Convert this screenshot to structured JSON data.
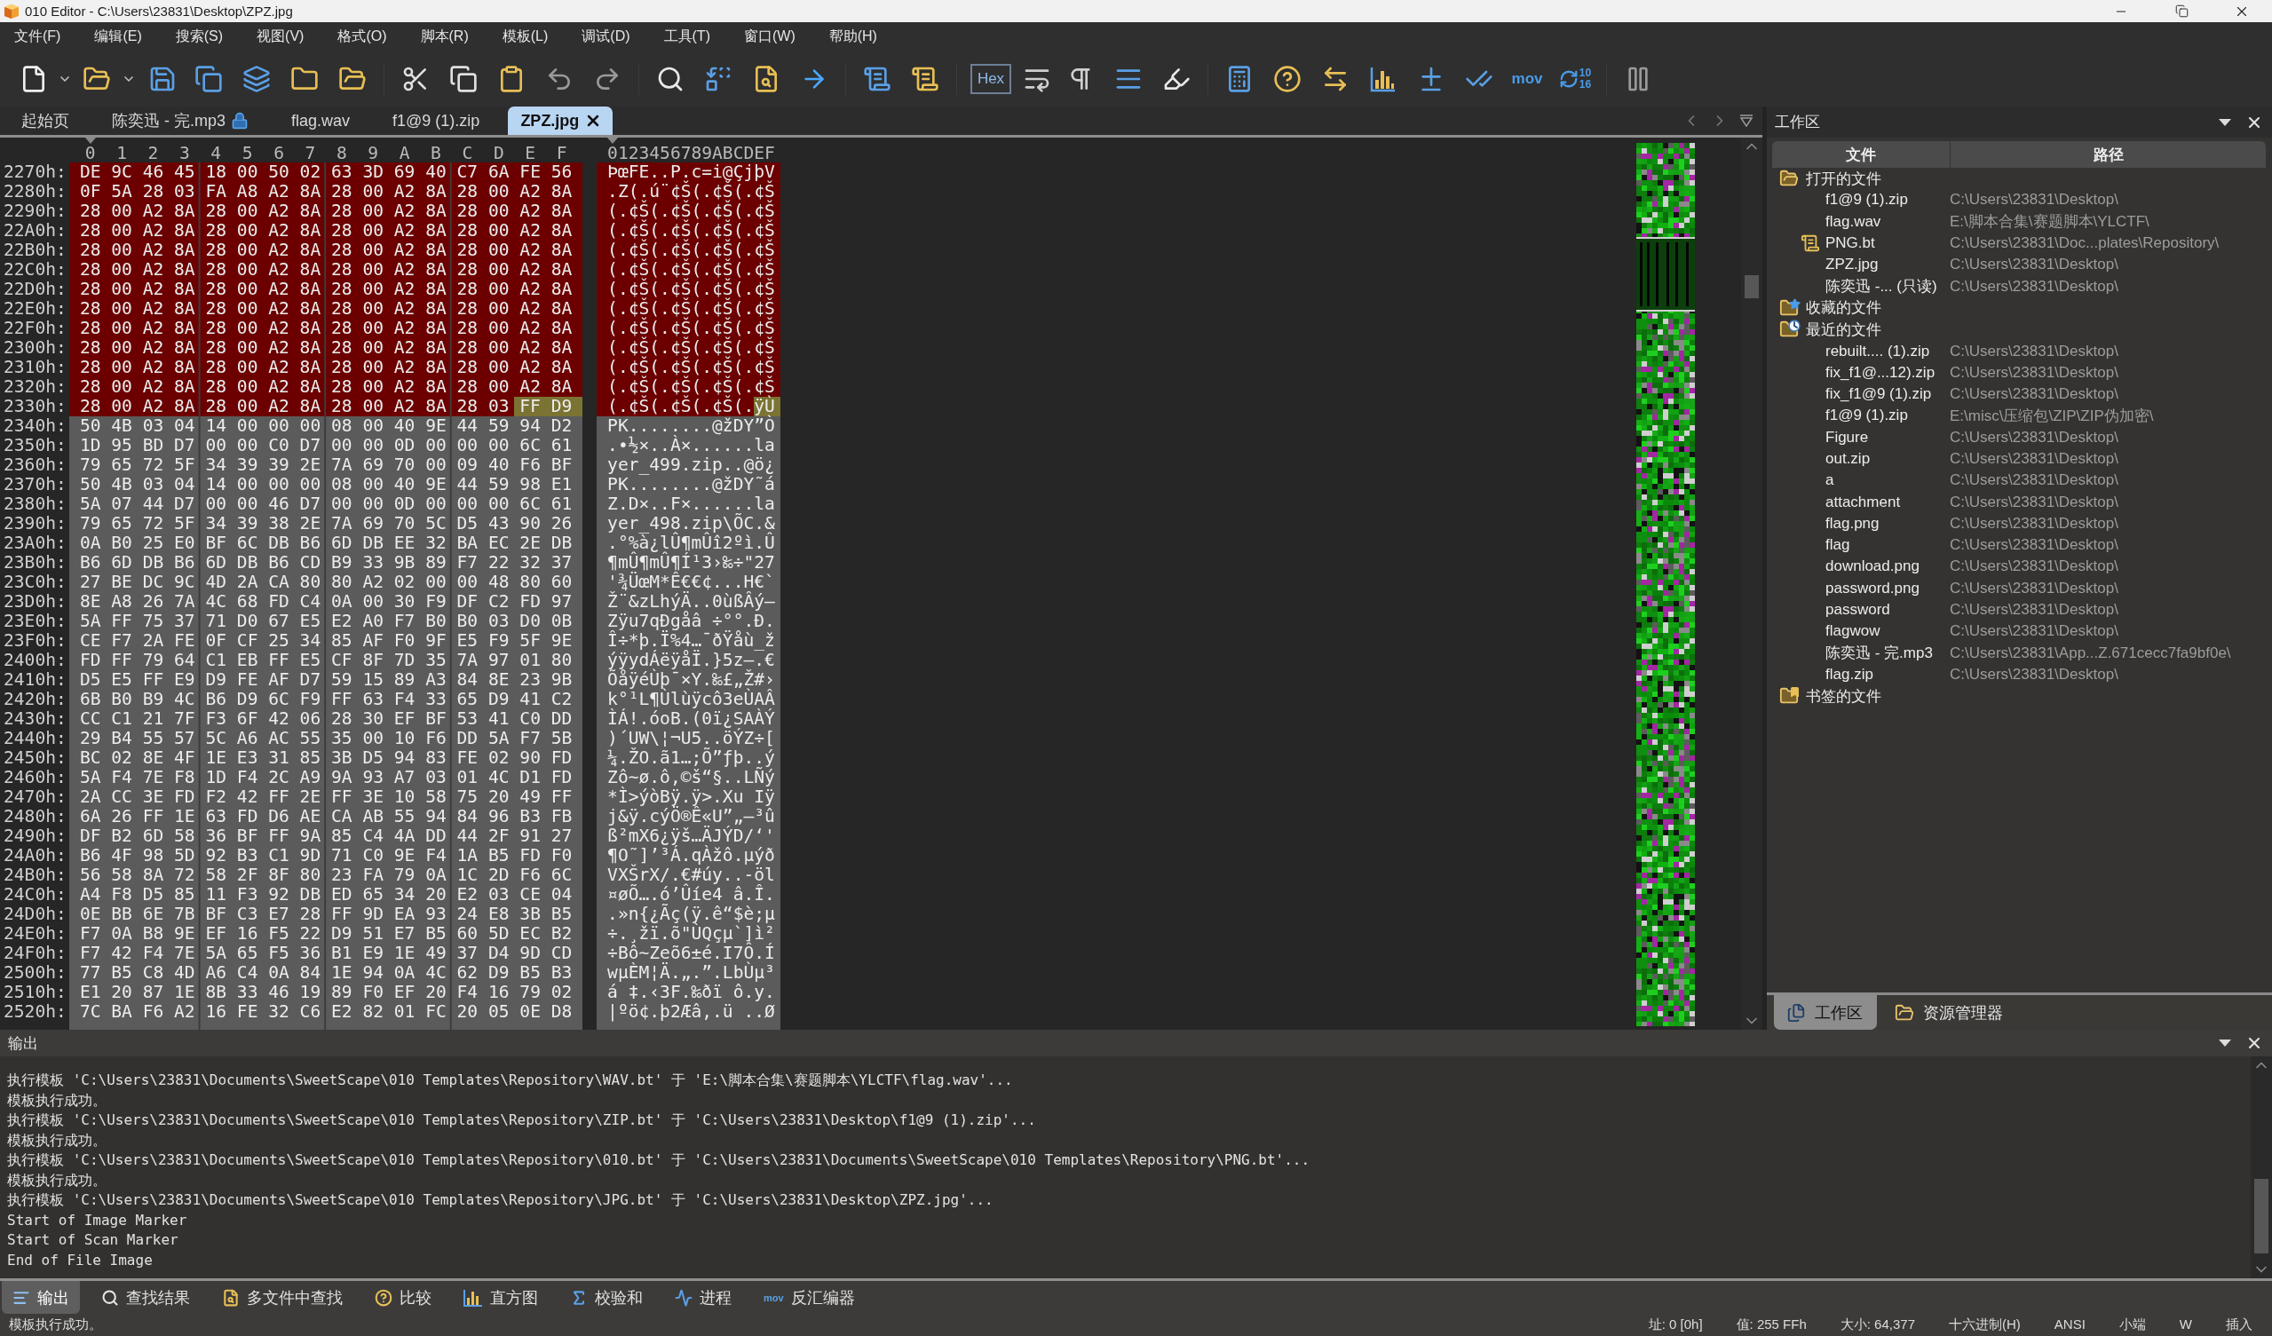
{
  "window": {
    "title": "010 Editor - C:\\Users\\23831\\Desktop\\ZPZ.jpg"
  },
  "menu": [
    "文件(F)",
    "编辑(E)",
    "搜索(S)",
    "视图(V)",
    "格式(O)",
    "脚本(R)",
    "模板(L)",
    "调试(D)",
    "工具(T)",
    "窗口(W)",
    "帮助(H)"
  ],
  "toolbar": {
    "hex_toggle": {
      "label": "Hex",
      "on": true
    },
    "disassembler_label": "mov",
    "base_labels": [
      "10",
      "16"
    ]
  },
  "tabs": [
    {
      "label": "起始页",
      "selected": false,
      "locked": false
    },
    {
      "label": "陈奕迅 - 完.mp3",
      "selected": false,
      "locked": true
    },
    {
      "label": "flag.wav",
      "selected": false,
      "locked": false
    },
    {
      "label": "f1@9 (1).zip",
      "selected": false,
      "locked": false
    },
    {
      "label": "ZPZ.jpg",
      "selected": true,
      "locked": false
    }
  ],
  "hex_view": {
    "column_headers": [
      "0",
      "1",
      "2",
      "3",
      "4",
      "5",
      "6",
      "7",
      "8",
      "9",
      "A",
      "B",
      "C",
      "D",
      "E",
      "F"
    ],
    "ascii_header": "0123456789ABCDEF",
    "rows": [
      {
        "offset": "2270h:",
        "groups": [
          {
            "kind": "scan-data",
            "hex": "DE 9C 46 45 18 00 50 02 63 3D 69 40 C7 6A FE 56",
            "ascii": "ÞœFE..P.c=i@ÇjþV"
          }
        ]
      },
      {
        "offset": "2280h:",
        "groups": [
          {
            "kind": "scan-data",
            "hex": "0F 5A 28 03 FA A8 A2 8A 28 00 A2 8A 28 00 A2 8A",
            "ascii": ".Z(.ú¨¢Š(.¢Š(.¢Š"
          }
        ]
      },
      {
        "offset": "2290h:",
        "groups": [
          {
            "kind": "scan-data",
            "hex": "28 00 A2 8A 28 00 A2 8A 28 00 A2 8A 28 00 A2 8A",
            "ascii": "(.¢Š(.¢Š(.¢Š(.¢Š"
          }
        ]
      },
      {
        "offset": "22A0h:",
        "groups": [
          {
            "kind": "scan-data",
            "hex": "28 00 A2 8A 28 00 A2 8A 28 00 A2 8A 28 00 A2 8A",
            "ascii": "(.¢Š(.¢Š(.¢Š(.¢Š"
          }
        ]
      },
      {
        "offset": "22B0h:",
        "groups": [
          {
            "kind": "scan-data",
            "hex": "28 00 A2 8A 28 00 A2 8A 28 00 A2 8A 28 00 A2 8A",
            "ascii": "(.¢Š(.¢Š(.¢Š(.¢Š"
          }
        ]
      },
      {
        "offset": "22C0h:",
        "groups": [
          {
            "kind": "scan-data",
            "hex": "28 00 A2 8A 28 00 A2 8A 28 00 A2 8A 28 00 A2 8A",
            "ascii": "(.¢Š(.¢Š(.¢Š(.¢Š"
          }
        ]
      },
      {
        "offset": "22D0h:",
        "groups": [
          {
            "kind": "scan-data",
            "hex": "28 00 A2 8A 28 00 A2 8A 28 00 A2 8A 28 00 A2 8A",
            "ascii": "(.¢Š(.¢Š(.¢Š(.¢Š"
          }
        ]
      },
      {
        "offset": "22E0h:",
        "groups": [
          {
            "kind": "scan-data",
            "hex": "28 00 A2 8A 28 00 A2 8A 28 00 A2 8A 28 00 A2 8A",
            "ascii": "(.¢Š(.¢Š(.¢Š(.¢Š"
          }
        ]
      },
      {
        "offset": "22F0h:",
        "groups": [
          {
            "kind": "scan-data",
            "hex": "28 00 A2 8A 28 00 A2 8A 28 00 A2 8A 28 00 A2 8A",
            "ascii": "(.¢Š(.¢Š(.¢Š(.¢Š"
          }
        ]
      },
      {
        "offset": "2300h:",
        "groups": [
          {
            "kind": "scan-data",
            "hex": "28 00 A2 8A 28 00 A2 8A 28 00 A2 8A 28 00 A2 8A",
            "ascii": "(.¢Š(.¢Š(.¢Š(.¢Š"
          }
        ]
      },
      {
        "offset": "2310h:",
        "groups": [
          {
            "kind": "scan-data",
            "hex": "28 00 A2 8A 28 00 A2 8A 28 00 A2 8A 28 00 A2 8A",
            "ascii": "(.¢Š(.¢Š(.¢Š(.¢Š"
          }
        ]
      },
      {
        "offset": "2320h:",
        "groups": [
          {
            "kind": "scan-data",
            "hex": "28 00 A2 8A 28 00 A2 8A 28 00 A2 8A 28 00 A2 8A",
            "ascii": "(.¢Š(.¢Š(.¢Š(.¢Š"
          }
        ]
      },
      {
        "offset": "2330h:",
        "groups": [
          {
            "kind": "scan-data",
            "hex": "28 00 A2 8A 28 00 A2 8A 28 00 A2 8A 28 03",
            "ascii": "(.¢Š(.¢Š(.¢Š(."
          },
          {
            "kind": "end-marker",
            "hex": "FF D9",
            "ascii": "ÿÙ"
          }
        ]
      },
      {
        "offset": "2340h:",
        "groups": [
          {
            "kind": "plain",
            "hex": "50 4B 03 04 14 00 00 00 08 00 40 9E 44 59 94 D2",
            "ascii": "PK........@žDY”Ò"
          }
        ]
      },
      {
        "offset": "2350h:",
        "groups": [
          {
            "kind": "plain",
            "hex": "1D 95 BD D7 00 00 C0 D7 00 00 0D 00 00 00 6C 61",
            "ascii": ".•½×..À×......la"
          }
        ]
      },
      {
        "offset": "2360h:",
        "groups": [
          {
            "kind": "plain",
            "hex": "79 65 72 5F 34 39 39 2E 7A 69 70 00 09 40 F6 BF",
            "ascii": "yer_499.zip..@ö¿"
          }
        ]
      },
      {
        "offset": "2370h:",
        "groups": [
          {
            "kind": "plain",
            "hex": "50 4B 03 04 14 00 00 00 08 00 40 9E 44 59 98 E1",
            "ascii": "PK........@žDY˜á"
          }
        ]
      },
      {
        "offset": "2380h:",
        "groups": [
          {
            "kind": "plain",
            "hex": "5A 07 44 D7 00 00 46 D7 00 00 0D 00 00 00 6C 61",
            "ascii": "Z.D×..F×......la"
          }
        ]
      },
      {
        "offset": "2390h:",
        "groups": [
          {
            "kind": "plain",
            "hex": "79 65 72 5F 34 39 38 2E 7A 69 70 5C D5 43 90 26",
            "ascii": "yer_498.zip\\ÕC.&"
          }
        ]
      },
      {
        "offset": "23A0h:",
        "groups": [
          {
            "kind": "plain",
            "hex": "0A B0 25 E0 BF 6C DB B6 6D DB EE 32 BA EC 2E DB",
            "ascii": ".°%à¿lÛ¶mÛî2ºì.Û"
          }
        ]
      },
      {
        "offset": "23B0h:",
        "groups": [
          {
            "kind": "plain",
            "hex": "B6 6D DB B6 6D DB B6 CD B9 33 9B 89 F7 22 32 37",
            "ascii": "¶mÛ¶mÛ¶Í¹3›‰÷\"27"
          }
        ]
      },
      {
        "offset": "23C0h:",
        "groups": [
          {
            "kind": "plain",
            "hex": "27 BE DC 9C 4D 2A CA 80 80 A2 02 00 00 48 80 60",
            "ascii": "'¾ÜœM*Ê€€¢...H€`"
          }
        ]
      },
      {
        "offset": "23D0h:",
        "groups": [
          {
            "kind": "plain",
            "hex": "8E A8 26 7A 4C 68 FD C4 0A 00 30 F9 DF C2 FD 97",
            "ascii": "Ž¨&zLhýÄ..0ùßÂý—"
          }
        ]
      },
      {
        "offset": "23E0h:",
        "groups": [
          {
            "kind": "plain",
            "hex": "5A FF 75 37 71 D0 67 E5 E2 A0 F7 B0 B0 03 D0 0B",
            "ascii": "Zÿu7qÐgåâ ÷°°.Ð."
          }
        ]
      },
      {
        "offset": "23F0h:",
        "groups": [
          {
            "kind": "plain",
            "hex": "CE F7 2A FE 0F CF 25 34 85 AF F0 9F E5 F9 5F 9E",
            "ascii": "Î÷*þ.Ï%4…¯ðŸåù_ž"
          }
        ]
      },
      {
        "offset": "2400h:",
        "groups": [
          {
            "kind": "plain",
            "hex": "FD FF 79 64 C1 EB FF E5 CF 8F 7D 35 7A 97 01 80",
            "ascii": "ýÿydÁëÿåÏ.}5z—.€"
          }
        ]
      },
      {
        "offset": "2410h:",
        "groups": [
          {
            "kind": "plain",
            "hex": "D5 E5 FF E9 D9 FE AF D7 59 15 89 A3 84 8E 23 9B",
            "ascii": "ÕåÿéÙþ¯×Y.‰£„Ž#›"
          }
        ]
      },
      {
        "offset": "2420h:",
        "groups": [
          {
            "kind": "plain",
            "hex": "6B B0 B9 4C B6 D9 6C F9 FF 63 F4 33 65 D9 41 C2",
            "ascii": "k°¹L¶Ùlùÿcô3eÙAÂ"
          }
        ]
      },
      {
        "offset": "2430h:",
        "groups": [
          {
            "kind": "plain",
            "hex": "CC C1 21 7F F3 6F 42 06 28 30 EF BF 53 41 C0 DD",
            "ascii": "ÌÁ!.óoB.(0ï¿SAÀÝ"
          }
        ]
      },
      {
        "offset": "2440h:",
        "groups": [
          {
            "kind": "plain",
            "hex": "29 B4 55 57 5C A6 AC 55 35 00 10 F6 DD 5A F7 5B",
            "ascii": ")´UW\\¦¬U5..öÝZ÷["
          }
        ]
      },
      {
        "offset": "2450h:",
        "groups": [
          {
            "kind": "plain",
            "hex": "BC 02 8E 4F 1E E3 31 85 3B D5 94 83 FE 02 90 FD",
            "ascii": "¼.ŽO.ã1…;Õ”ƒþ..ý"
          }
        ]
      },
      {
        "offset": "2460h:",
        "groups": [
          {
            "kind": "plain",
            "hex": "5A F4 7E F8 1D F4 2C A9 9A 93 A7 03 01 4C D1 FD",
            "ascii": "Zô~ø.ô,©š“§..LÑý"
          }
        ]
      },
      {
        "offset": "2470h:",
        "groups": [
          {
            "kind": "plain",
            "hex": "2A CC 3E FD F2 42 FF 2E FF 3E 10 58 75 20 49 FF",
            "ascii": "*Ì>ýòBÿ.ÿ>.Xu Iÿ"
          }
        ]
      },
      {
        "offset": "2480h:",
        "groups": [
          {
            "kind": "plain",
            "hex": "6A 26 FF 1E 63 FD D6 AE CA AB 55 94 84 96 B3 FB",
            "ascii": "j&ÿ.cýÖ®Ê«U”„–³û"
          }
        ]
      },
      {
        "offset": "2490h:",
        "groups": [
          {
            "kind": "plain",
            "hex": "DF B2 6D 58 36 BF FF 9A 85 C4 4A DD 44 2F 91 27",
            "ascii": "ß²mX6¿ÿš…ÄJÝD/‘'"
          }
        ]
      },
      {
        "offset": "24A0h:",
        "groups": [
          {
            "kind": "plain",
            "hex": "B6 4F 98 5D 92 B3 C1 9D 71 C0 9E F4 1A B5 FD F0",
            "ascii": "¶O˜]’³Á.qÀžô.µýð"
          }
        ]
      },
      {
        "offset": "24B0h:",
        "groups": [
          {
            "kind": "plain",
            "hex": "56 58 8A 72 58 2F 8F 80 23 FA 79 0A 1C 2D F6 6C",
            "ascii": "VXŠrX/.€#úy..-öl"
          }
        ]
      },
      {
        "offset": "24C0h:",
        "groups": [
          {
            "kind": "plain",
            "hex": "A4 F8 D5 85 11 F3 92 DB ED 65 34 20 E2 03 CE 04",
            "ascii": "¤øÕ….ó’Ûíe4 â.Î."
          }
        ]
      },
      {
        "offset": "24D0h:",
        "groups": [
          {
            "kind": "plain",
            "hex": "0E BB 6E 7B BF C3 E7 28 FF 9D EA 93 24 E8 3B B5",
            "ascii": ".»n{¿Ãç(ÿ.ê“$è;µ"
          }
        ]
      },
      {
        "offset": "24E0h:",
        "groups": [
          {
            "kind": "plain",
            "hex": "F7 0A B8 9E EF 16 F5 22 D9 51 E7 B5 60 5D EC B2",
            "ascii": "÷.¸žï.õ\"ÙQçµ`]ì²"
          }
        ]
      },
      {
        "offset": "24F0h:",
        "groups": [
          {
            "kind": "plain",
            "hex": "F7 42 F4 7E 5A 65 F5 36 B1 E9 1E 49 37 D4 9D CD",
            "ascii": "÷Bô~Zeõ6±é.I7Ô.Í"
          }
        ]
      },
      {
        "offset": "2500h:",
        "groups": [
          {
            "kind": "plain",
            "hex": "77 B5 C8 4D A6 C4 0A 84 1E 94 0A 4C 62 D9 B5 B3",
            "ascii": "wµÈM¦Ä.„.”.LbÙµ³"
          }
        ]
      },
      {
        "offset": "2510h:",
        "groups": [
          {
            "kind": "plain",
            "hex": "E1 20 87 1E 8B 33 46 19 89 F0 EF 20 F4 16 79 02",
            "ascii": "á ‡.‹3F.‰ðï ô.y."
          }
        ]
      },
      {
        "offset": "2520h:",
        "groups": [
          {
            "kind": "plain",
            "hex": "7C BA F6 A2 16 FE 32 C6 E2 82 01 FC 20 05 0E D8",
            "ascii": "|ºö¢.þ2Æâ‚.ü ..Ø"
          }
        ]
      }
    ]
  },
  "workspace": {
    "title": "工作区",
    "columns": [
      "文件",
      "路径"
    ],
    "tree": [
      {
        "label": "打开的文件",
        "kind": "open",
        "children": [
          {
            "name": "f1@9 (1).zip",
            "path": "C:\\Users\\23831\\Desktop\\",
            "kind": "file"
          },
          {
            "name": "flag.wav",
            "path": "E:\\脚本合集\\赛题脚本\\YLCTF\\",
            "kind": "file"
          },
          {
            "name": "PNG.bt",
            "path": "C:\\Users\\23831\\Doc...plates\\Repository\\",
            "kind": "template"
          },
          {
            "name": "ZPZ.jpg",
            "path": "C:\\Users\\23831\\Desktop\\",
            "kind": "file"
          },
          {
            "name": "陈奕迅 -... (只读)",
            "path": "C:\\Users\\23831\\Desktop\\",
            "kind": "file"
          }
        ]
      },
      {
        "label": "收藏的文件",
        "kind": "favorites"
      },
      {
        "label": "最近的文件",
        "kind": "recent",
        "children": [
          {
            "name": "rebuilt.... (1).zip",
            "path": "C:\\Users\\23831\\Desktop\\",
            "kind": "file"
          },
          {
            "name": "fix_f1@...12).zip",
            "path": "C:\\Users\\23831\\Desktop\\",
            "kind": "file"
          },
          {
            "name": "fix_f1@9 (1).zip",
            "path": "C:\\Users\\23831\\Desktop\\",
            "kind": "file"
          },
          {
            "name": "f1@9 (1).zip",
            "path": "E:\\misc\\压缩包\\ZIP\\ZIP伪加密\\",
            "kind": "file"
          },
          {
            "name": "Figure",
            "path": "C:\\Users\\23831\\Desktop\\",
            "kind": "file"
          },
          {
            "name": "out.zip",
            "path": "C:\\Users\\23831\\Desktop\\",
            "kind": "file"
          },
          {
            "name": "a",
            "path": "C:\\Users\\23831\\Desktop\\",
            "kind": "file"
          },
          {
            "name": "attachment",
            "path": "C:\\Users\\23831\\Desktop\\",
            "kind": "file"
          },
          {
            "name": "flag.png",
            "path": "C:\\Users\\23831\\Desktop\\",
            "kind": "file"
          },
          {
            "name": "flag",
            "path": "C:\\Users\\23831\\Desktop\\",
            "kind": "file"
          },
          {
            "name": "download.png",
            "path": "C:\\Users\\23831\\Desktop\\",
            "kind": "file"
          },
          {
            "name": "password.png",
            "path": "C:\\Users\\23831\\Desktop\\",
            "kind": "file"
          },
          {
            "name": "password",
            "path": "C:\\Users\\23831\\Desktop\\",
            "kind": "file"
          },
          {
            "name": "flagwow",
            "path": "C:\\Users\\23831\\Desktop\\",
            "kind": "file"
          },
          {
            "name": "陈奕迅 - 完.mp3",
            "path": "C:\\Users\\23831\\App...Z.671cecc7fa9bf0e\\",
            "kind": "file"
          },
          {
            "name": "flag.zip",
            "path": "C:\\Users\\23831\\Desktop\\",
            "kind": "file"
          }
        ]
      },
      {
        "label": "书签的文件",
        "kind": "bookmarks"
      }
    ],
    "tabs": [
      {
        "label": "工作区",
        "selected": true,
        "kind": "workspace"
      },
      {
        "label": "资源管理器",
        "selected": false,
        "kind": "explorer"
      }
    ]
  },
  "output": {
    "title": "输出",
    "lines": [
      "执行模板 'C:\\Users\\23831\\Documents\\SweetScape\\010 Templates\\Repository\\WAV.bt' 于 'E:\\脚本合集\\赛题脚本\\YLCTF\\flag.wav'...",
      "模板执行成功。",
      "执行模板 'C:\\Users\\23831\\Documents\\SweetScape\\010 Templates\\Repository\\ZIP.bt' 于 'C:\\Users\\23831\\Desktop\\f1@9 (1).zip'...",
      "模板执行成功。",
      "执行模板 'C:\\Users\\23831\\Documents\\SweetScape\\010 Templates\\Repository\\010.bt' 于 'C:\\Users\\23831\\Documents\\SweetScape\\010 Templates\\Repository\\PNG.bt'...",
      "模板执行成功。",
      "执行模板 'C:\\Users\\23831\\Documents\\SweetScape\\010 Templates\\Repository\\JPG.bt' 于 'C:\\Users\\23831\\Desktop\\ZPZ.jpg'...",
      "Start of Image Marker",
      "Start of Scan Marker",
      "End of File Image"
    ]
  },
  "bottom_tabs": [
    {
      "label": "输出",
      "selected": true,
      "kind": "output"
    },
    {
      "label": "查找结果",
      "selected": false,
      "kind": "find"
    },
    {
      "label": "多文件中查找",
      "selected": false,
      "kind": "find-in-files"
    },
    {
      "label": "比较",
      "selected": false,
      "kind": "compare"
    },
    {
      "label": "直方图",
      "selected": false,
      "kind": "histogram"
    },
    {
      "label": "校验和",
      "selected": false,
      "kind": "checksum"
    },
    {
      "label": "进程",
      "selected": false,
      "kind": "process"
    },
    {
      "label": "反汇编器",
      "selected": false,
      "kind": "disassembler",
      "icon_label": "mov"
    }
  ],
  "status_bar": {
    "message": "模板执行成功。",
    "fields": [
      "址: 0 [0h]",
      "值: 255 FFh",
      "大小: 64,377",
      "十六进制(H)",
      "ANSI",
      "小端",
      "W",
      "插入"
    ]
  }
}
